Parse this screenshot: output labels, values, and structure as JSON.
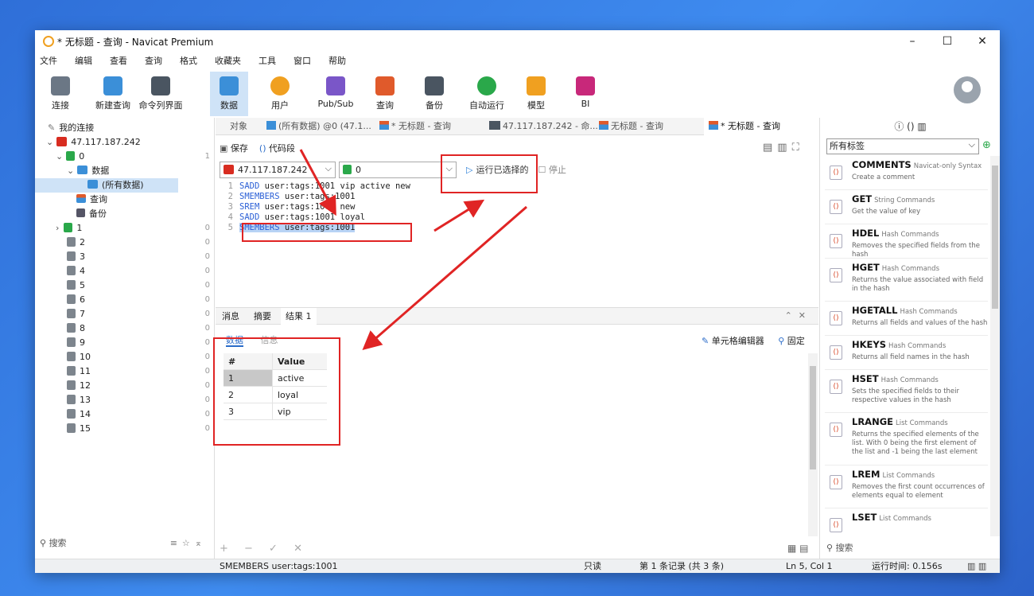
{
  "window": {
    "title": "* 无标题 - 查询 - Navicat Premium",
    "controls": [
      "–",
      "☐",
      "✕"
    ]
  },
  "menu": [
    "文件",
    "编辑",
    "查看",
    "查询",
    "格式",
    "收藏夹",
    "工具",
    "窗口",
    "帮助"
  ],
  "toolbar": {
    "items": [
      {
        "label": "连接",
        "icon": "connection-plug-icon",
        "color": "#6b7785"
      },
      {
        "label": "新建查询",
        "icon": "new-query-icon",
        "color": "#3b8fd8"
      },
      {
        "label": "命令列界面",
        "icon": "console-icon",
        "color": "#4a5561"
      },
      {
        "label": "数据",
        "icon": "table-icon",
        "color": "#3b8fd8"
      },
      {
        "label": "用户",
        "icon": "user-icon",
        "color": "#f0a020"
      },
      {
        "label": "Pub/Sub",
        "icon": "pubsub-icon",
        "color": "#7a56c8"
      },
      {
        "label": "查询",
        "icon": "query-icon",
        "color": "#e05a2b"
      },
      {
        "label": "备份",
        "icon": "backup-icon",
        "color": "#4a5561"
      },
      {
        "label": "自动运行",
        "icon": "robot-icon",
        "color": "#2aa84a"
      },
      {
        "label": "模型",
        "icon": "model-icon",
        "color": "#f0a020"
      },
      {
        "label": "BI",
        "icon": "bi-chart-icon",
        "color": "#c8287a"
      }
    ]
  },
  "left_panel": {
    "header": "我的连接",
    "connection": "47.117.187.242",
    "db0": {
      "label": "0",
      "count": "1"
    },
    "data_label": "数据",
    "all_data": "(所有数据)",
    "query_label": "查询",
    "backup_label": "备份",
    "dbs": [
      {
        "label": "1",
        "count": "0"
      },
      {
        "label": "2",
        "count": "0"
      },
      {
        "label": "3",
        "count": "0"
      },
      {
        "label": "4",
        "count": "0"
      },
      {
        "label": "5",
        "count": "0"
      },
      {
        "label": "6",
        "count": "0"
      },
      {
        "label": "7",
        "count": "0"
      },
      {
        "label": "8",
        "count": "0"
      },
      {
        "label": "9",
        "count": "0"
      },
      {
        "label": "10",
        "count": "0"
      },
      {
        "label": "11",
        "count": "0"
      },
      {
        "label": "12",
        "count": "0"
      },
      {
        "label": "13",
        "count": "0"
      },
      {
        "label": "14",
        "count": "0"
      },
      {
        "label": "15",
        "count": "0"
      }
    ],
    "search": "搜索"
  },
  "tabs": [
    {
      "label": "对象"
    },
    {
      "label": "(所有数据) @0 (47.1..."
    },
    {
      "label": "* 无标题 - 查询"
    },
    {
      "label": "47.117.187.242 - 命..."
    },
    {
      "label": "无标题 - 查询"
    },
    {
      "label": "* 无标题 - 查询"
    }
  ],
  "editor_toolbar": {
    "save": "保存",
    "snippet": "代码段",
    "connection": "47.117.187.242",
    "database": "0",
    "run_selected": "运行已选择的",
    "stop": "停止"
  },
  "code_lines": [
    {
      "num": "1",
      "cmd": "SADD",
      "rest": " user:tags:1001 vip active new"
    },
    {
      "num": "2",
      "cmd": "SMEMBERS",
      "rest": " user:tags:1001"
    },
    {
      "num": "3",
      "cmd": "SREM",
      "rest": " user:tags:1001 new"
    },
    {
      "num": "4",
      "cmd": "SADD",
      "rest": " user:tags:1001 loyal"
    },
    {
      "num": "5",
      "cmd": "SMEMBERS",
      "rest": " user:tags:1001"
    }
  ],
  "result": {
    "tabs": [
      "消息",
      "摘要",
      "结果 1"
    ],
    "subtabs": [
      "数据",
      "信息"
    ],
    "cell_editor": "单元格编辑器",
    "pin": "固定",
    "headers": [
      "#",
      "Value"
    ],
    "rows": [
      {
        "num": "1",
        "value": "active"
      },
      {
        "num": "2",
        "value": "loyal"
      },
      {
        "num": "3",
        "value": "vip"
      }
    ],
    "bottom_tools": "+ − ✓ ✕"
  },
  "status": {
    "query": "SMEMBERS user:tags:1001",
    "mode": "只读",
    "records": "第 1 条记录 (共 3 条)",
    "position": "Ln 5, Col 1",
    "runtime": "运行时间: 0.156s"
  },
  "right_panel": {
    "tag_filter": "所有标签",
    "search": "搜索",
    "snippets": [
      {
        "name": "COMMENTS",
        "cat": "Navicat-only Syntax",
        "desc": "Create a comment"
      },
      {
        "name": "GET",
        "cat": "String Commands",
        "desc": "Get the value of key"
      },
      {
        "name": "HDEL",
        "cat": "Hash Commands",
        "desc": "Removes the specified fields from the hash"
      },
      {
        "name": "HGET",
        "cat": "Hash Commands",
        "desc": "Returns the value associated with field in the hash"
      },
      {
        "name": "HGETALL",
        "cat": "Hash Commands",
        "desc": "Returns all fields and values of the hash"
      },
      {
        "name": "HKEYS",
        "cat": "Hash Commands",
        "desc": "Returns all field names in the hash"
      },
      {
        "name": "HSET",
        "cat": "Hash Commands",
        "desc": "Sets the specified fields to their respective values in the hash"
      },
      {
        "name": "LRANGE",
        "cat": "List Commands",
        "desc": "Returns the specified elements of the list. With 0 being the first element of the list and -1 being the last element"
      },
      {
        "name": "LREM",
        "cat": "List Commands",
        "desc": "Removes the first count occurrences of elements equal to element"
      },
      {
        "name": "LSET",
        "cat": "List Commands",
        "desc": ""
      }
    ]
  },
  "colors": {
    "accent": "#2b6cc9",
    "annotation": "#e02424",
    "redis": "#d82c20",
    "db_active": "#2aa84a"
  }
}
